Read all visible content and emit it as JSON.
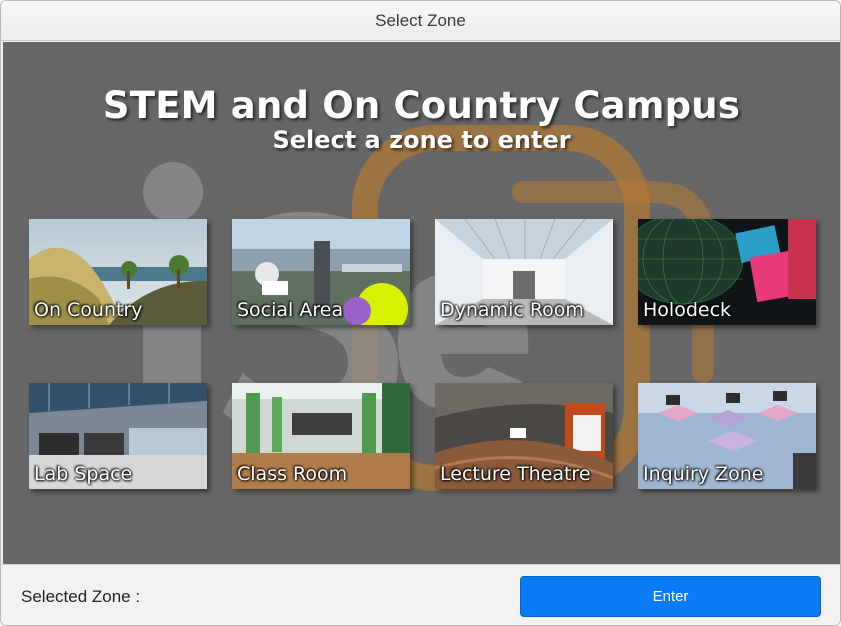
{
  "window": {
    "title": "Select Zone"
  },
  "header": {
    "title": "STEM and On Country Campus",
    "subtitle": "Select a zone to enter"
  },
  "zones": [
    {
      "label": "On Country",
      "icon": "on-country-thumbnail"
    },
    {
      "label": "Social Area",
      "icon": "social-area-thumbnail"
    },
    {
      "label": "Dynamic Room",
      "icon": "dynamic-room-thumbnail"
    },
    {
      "label": "Holodeck",
      "icon": "holodeck-thumbnail"
    },
    {
      "label": "Lab Space",
      "icon": "lab-space-thumbnail"
    },
    {
      "label": "Class Room",
      "icon": "class-room-thumbnail"
    },
    {
      "label": "Lecture Theatre",
      "icon": "lecture-theatre-thumbnail"
    },
    {
      "label": "Inquiry Zone",
      "icon": "inquiry-zone-thumbnail"
    }
  ],
  "footer": {
    "selected_label": "Selected Zone :",
    "enter_label": "Enter"
  },
  "colors": {
    "stage_bg": "#676767",
    "enter_button": "#0a7cf5",
    "logo_orange": "#c58a3a"
  }
}
